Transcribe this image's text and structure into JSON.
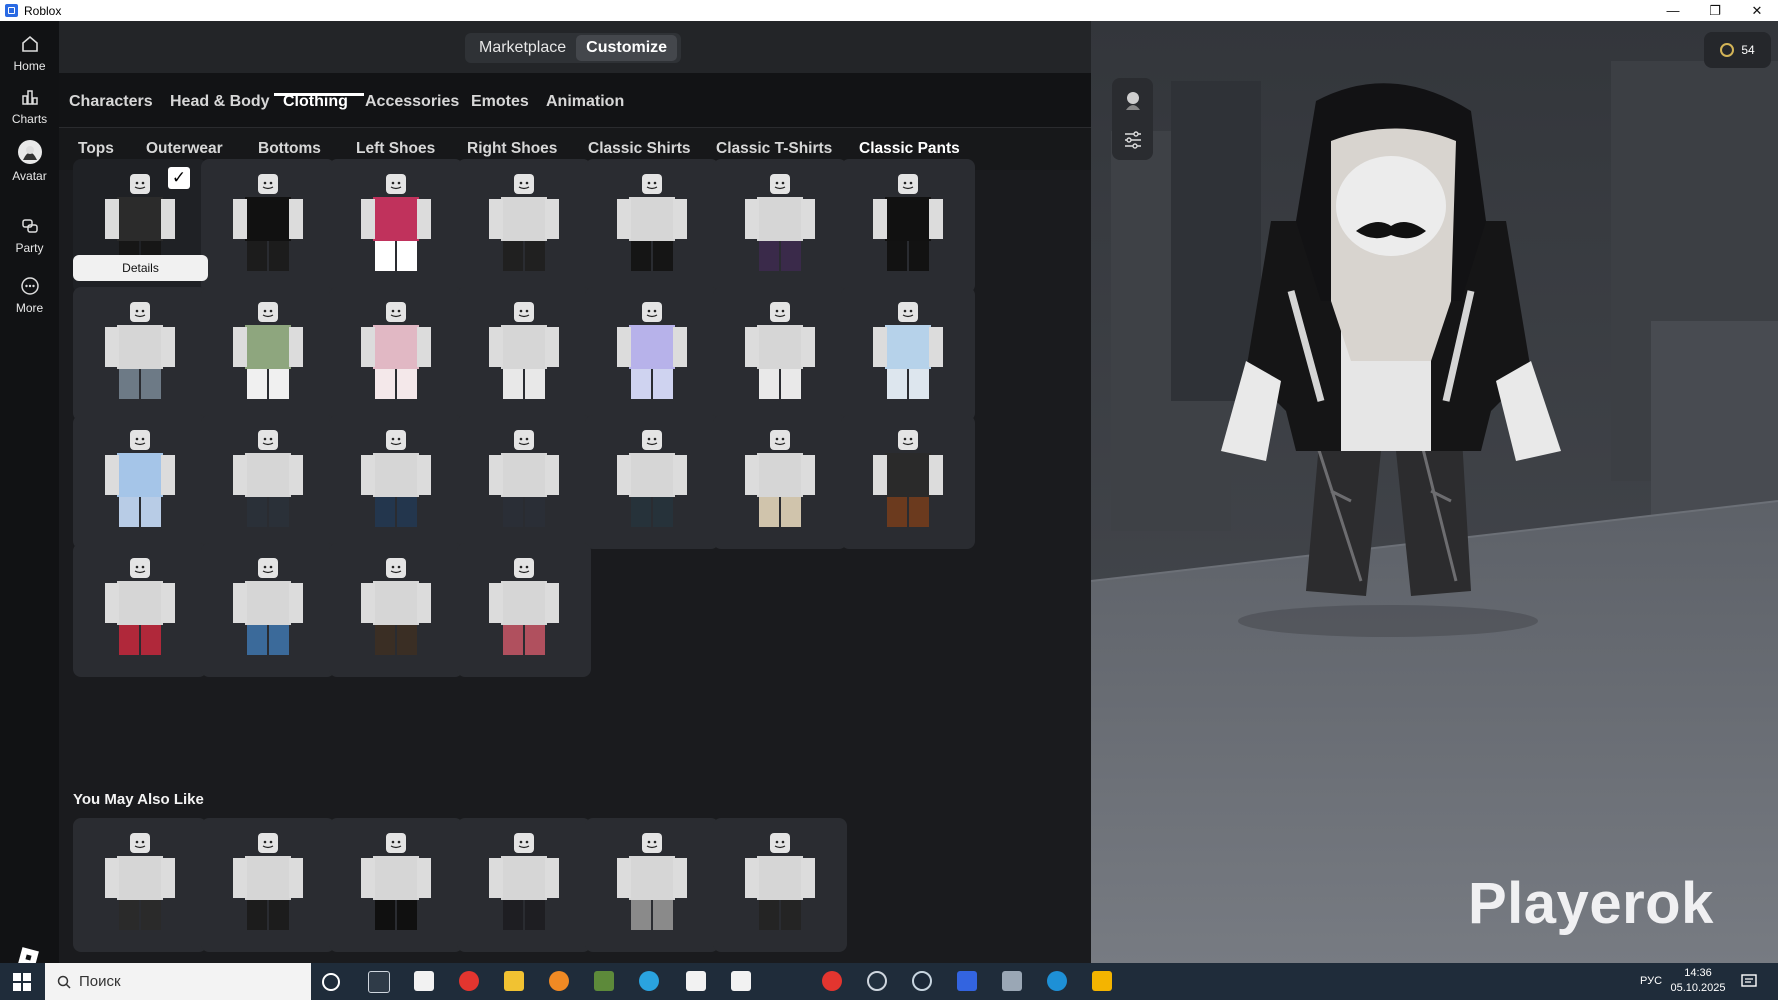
{
  "window": {
    "title": "Roblox",
    "controls": [
      "—",
      "❐",
      "✕"
    ]
  },
  "nav": {
    "items": [
      {
        "label": "Home",
        "icon": "home-icon"
      },
      {
        "label": "Charts",
        "icon": "charts-icon"
      },
      {
        "label": "Avatar",
        "icon": "avatar-icon"
      },
      {
        "label": "Party",
        "icon": "party-icon"
      },
      {
        "label": "More",
        "icon": "more-icon"
      }
    ]
  },
  "topbar": {
    "marketplace": "Marketplace",
    "customize": "Customize"
  },
  "categories": [
    "Characters",
    "Head & Body",
    "Clothing",
    "Accessories",
    "Emotes",
    "Animation"
  ],
  "active_category": "Clothing",
  "subcategories": [
    "Tops",
    "Outerwear",
    "Bottoms",
    "Left Shoes",
    "Right Shoes",
    "Classic Shirts",
    "Classic T-Shirts",
    "Classic Pants"
  ],
  "active_subcategory": "Classic Pants",
  "grid": {
    "details_label": "Details",
    "equipped_check": "✓",
    "items": [
      {
        "pants": "#1a1a1a",
        "shirt": "#2a2a2a",
        "equipped": true
      },
      {
        "pants": "#1c1c1c",
        "shirt": "#111111"
      },
      {
        "pants": "#ffffff",
        "shirt": "#c0325c"
      },
      {
        "pants": "#202020",
        "shirt": "#d6d6d6"
      },
      {
        "pants": "#151515",
        "shirt": "#d6d6d6"
      },
      {
        "pants": "#3a2a4a",
        "shirt": "#d6d6d6"
      },
      {
        "pants": "#121212",
        "shirt": "#111111"
      },
      {
        "pants": "#6d7a86",
        "shirt": "#d6d6d6"
      },
      {
        "pants": "#f0f0f0",
        "shirt": "#8ea67e"
      },
      {
        "pants": "#f4e8ea",
        "shirt": "#e1b8c4"
      },
      {
        "pants": "#e8e8e8",
        "shirt": "#d6d6d6"
      },
      {
        "pants": "#cfd3f0",
        "shirt": "#b7b2ea"
      },
      {
        "pants": "#e9e9e9",
        "shirt": "#d6d6d6"
      },
      {
        "pants": "#dde6ee",
        "shirt": "#b6d2ea"
      },
      {
        "pants": "#b8cce6",
        "shirt": "#a5c5e8"
      },
      {
        "pants": "#2a3038",
        "shirt": "#d6d6d6"
      },
      {
        "pants": "#23364d",
        "shirt": "#d6d6d6"
      },
      {
        "pants": "#2a2e36",
        "shirt": "#d6d6d6"
      },
      {
        "pants": "#26323a",
        "shirt": "#d6d6d6"
      },
      {
        "pants": "#d0c4ac",
        "shirt": "#d6d6d6"
      },
      {
        "pants": "#6b3a1e",
        "shirt": "#2a2a2a"
      },
      {
        "pants": "#b0283a",
        "shirt": "#d6d6d6"
      },
      {
        "pants": "#3b6a9a",
        "shirt": "#d6d6d6"
      },
      {
        "pants": "#3a2e24",
        "shirt": "#d6d6d6"
      },
      {
        "pants": "#b0505e",
        "shirt": "#d6d6d6"
      }
    ]
  },
  "recommend": {
    "title": "You May Also Like",
    "items": [
      {
        "pants": "#2a2a2a",
        "shirt": "#d6d6d6"
      },
      {
        "pants": "#1c1c1c",
        "shirt": "#d6d6d6"
      },
      {
        "pants": "#101010",
        "shirt": "#d6d6d6"
      },
      {
        "pants": "#1e1e22",
        "shirt": "#d6d6d6"
      },
      {
        "pants": "#8a8a8a",
        "shirt": "#d6d6d6"
      },
      {
        "pants": "#242424",
        "shirt": "#d6d6d6"
      }
    ]
  },
  "robux": {
    "amount": "54"
  },
  "watermark": "Playerok",
  "taskbar": {
    "search_placeholder": "Поиск",
    "language": "РУС",
    "time": "14:36",
    "date": "05.10.2025"
  }
}
